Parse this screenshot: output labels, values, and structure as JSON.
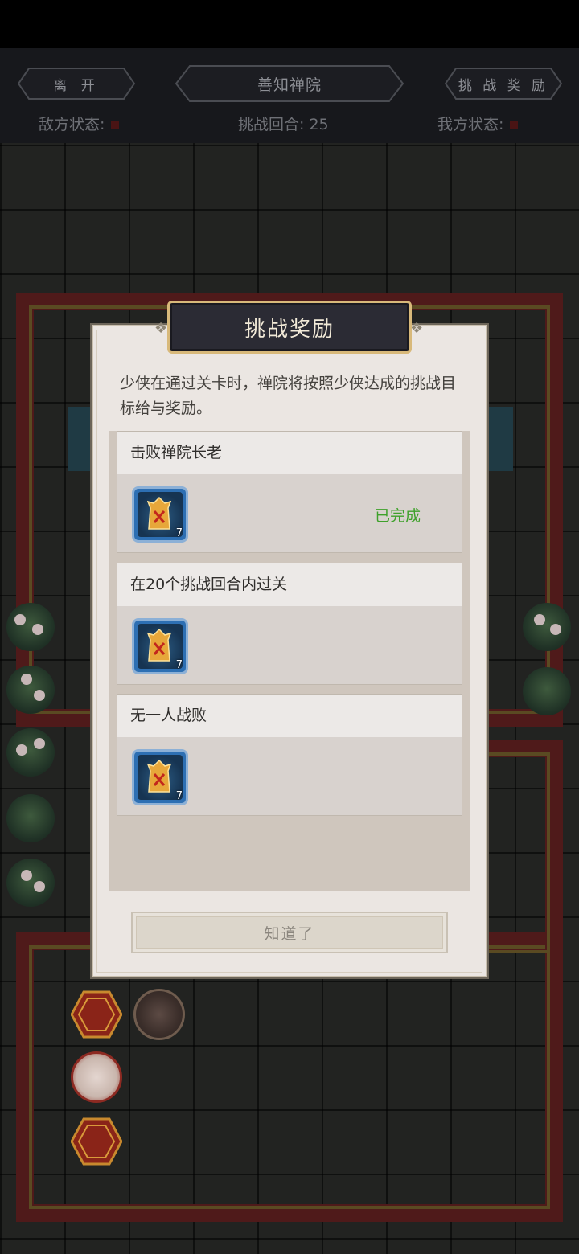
{
  "header": {
    "leave_label": "离 开",
    "location_title": "善知禅院",
    "rewards_label": "挑 战 奖 励",
    "enemy_status_label": "敌方状态:",
    "round_label": "挑战回合:",
    "round_value": "25",
    "ally_status_label": "我方状态:"
  },
  "dialog": {
    "title": "挑战奖励",
    "description": "少侠在通过关卡时，禅院将按照少侠达成的挑战目标给与奖励。",
    "objectives": [
      {
        "label": "击败禅院长老",
        "reward_qty": "7",
        "reward_icon": "scroll-token-icon",
        "status": "已完成"
      },
      {
        "label": "在20个挑战回合内过关",
        "reward_qty": "7",
        "reward_icon": "scroll-token-icon",
        "status": ""
      },
      {
        "label": "无一人战败",
        "reward_qty": "7",
        "reward_icon": "scroll-token-icon",
        "status": ""
      }
    ],
    "confirm_label": "知道了"
  },
  "colors": {
    "completed": "#3ea12a",
    "title_plate": "#2b2b34",
    "title_border": "#d8b97a",
    "wall": "#4f1a1a"
  }
}
